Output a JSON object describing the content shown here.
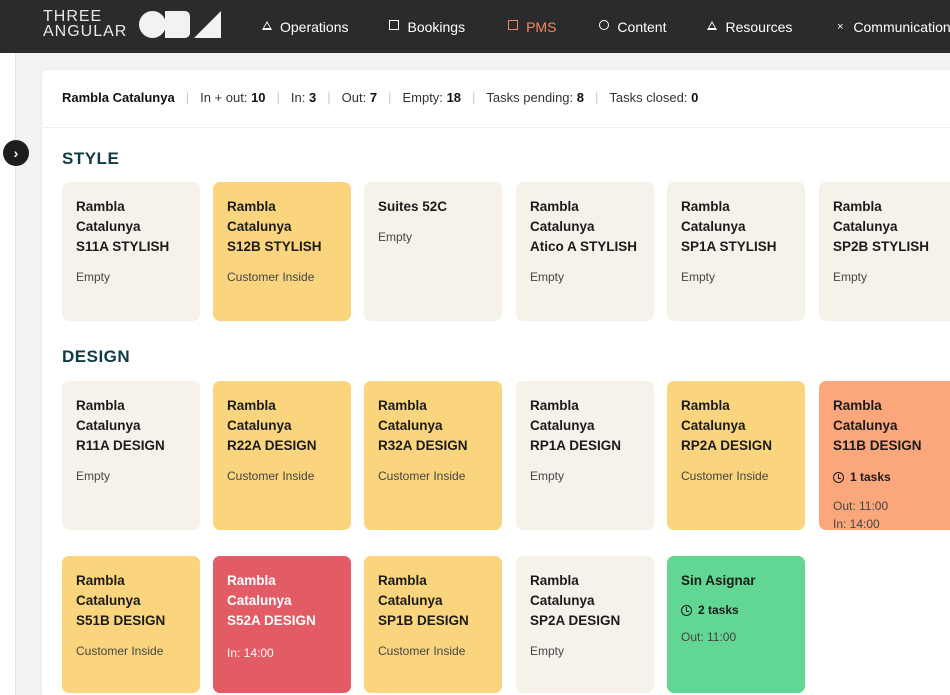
{
  "brand": {
    "line1": "THREE",
    "line2": "ANGULAR"
  },
  "nav": [
    {
      "label": "Operations",
      "icon": "triangle-icon",
      "active": false
    },
    {
      "label": "Bookings",
      "icon": "square-icon",
      "active": false
    },
    {
      "label": "PMS",
      "icon": "square-icon",
      "active": true
    },
    {
      "label": "Content",
      "icon": "circle-icon",
      "active": false
    },
    {
      "label": "Resources",
      "icon": "triangle-icon",
      "active": false
    },
    {
      "label": "Communications",
      "icon": "close-icon",
      "active": false
    }
  ],
  "accent_color": "#f08a5d",
  "toggle_icon": "chevron-right-icon",
  "stats": {
    "location": "Rambla Catalunya",
    "in_out_label": "In + out:",
    "in_out": "10",
    "in_label": "In:",
    "in": "3",
    "out_label": "Out:",
    "out": "7",
    "empty_label": "Empty:",
    "empty": "18",
    "pending_label": "Tasks pending:",
    "pending": "8",
    "closed_label": "Tasks closed:",
    "closed": "0"
  },
  "sections": [
    {
      "title": "STYLE",
      "cards": [
        {
          "line1": "Rambla Catalunya",
          "line2": "S11A STYLISH",
          "status": "Empty",
          "kind": "empty"
        },
        {
          "line1": "Rambla Catalunya",
          "line2": "S12B STYLISH",
          "status": "Customer Inside",
          "kind": "inside"
        },
        {
          "line1": "Suites 52C",
          "line2": "",
          "status": "Empty",
          "kind": "empty"
        },
        {
          "line1": "Rambla Catalunya",
          "line2": "Atico A STYLISH",
          "status": "Empty",
          "kind": "empty"
        },
        {
          "line1": "Rambla Catalunya",
          "line2": "SP1A STYLISH",
          "status": "Empty",
          "kind": "empty"
        },
        {
          "line1": "Rambla Catalunya",
          "line2": "SP2B STYLISH",
          "status": "Empty",
          "kind": "empty"
        }
      ]
    },
    {
      "title": "DESIGN",
      "cards": [
        {
          "line1": "Rambla Catalunya",
          "line2": "R11A DESIGN",
          "status": "Empty",
          "kind": "empty"
        },
        {
          "line1": "Rambla Catalunya",
          "line2": "R22A DESIGN",
          "status": "Customer Inside",
          "kind": "inside"
        },
        {
          "line1": "Rambla Catalunya",
          "line2": "R32A DESIGN",
          "status": "Customer Inside",
          "kind": "inside"
        },
        {
          "line1": "Rambla Catalunya",
          "line2": "RP1A DESIGN",
          "status": "Empty",
          "kind": "empty"
        },
        {
          "line1": "Rambla Catalunya",
          "line2": "RP2A DESIGN",
          "status": "Customer Inside",
          "kind": "inside"
        },
        {
          "line1": "Rambla Catalunya",
          "line2": "S11B DESIGN",
          "tasks": "1 tasks",
          "out": "Out: 11:00",
          "in": "In: 14:00",
          "kind": "task"
        },
        {
          "line1": "Rambla Catalunya",
          "line2": "S51B DESIGN",
          "status": "Customer Inside",
          "kind": "inside"
        },
        {
          "line1": "Rambla Catalunya",
          "line2": "S52A DESIGN",
          "in": "In: 14:00",
          "kind": "red"
        },
        {
          "line1": "Rambla Catalunya",
          "line2": "SP1B DESIGN",
          "status": "Customer Inside",
          "kind": "inside"
        },
        {
          "line1": "Rambla Catalunya",
          "line2": "SP2A DESIGN",
          "status": "Empty",
          "kind": "empty"
        },
        {
          "line1": "Sin Asignar",
          "line2": "",
          "tasks": "2 tasks",
          "out": "Out: 11:00",
          "kind": "green"
        }
      ]
    }
  ]
}
